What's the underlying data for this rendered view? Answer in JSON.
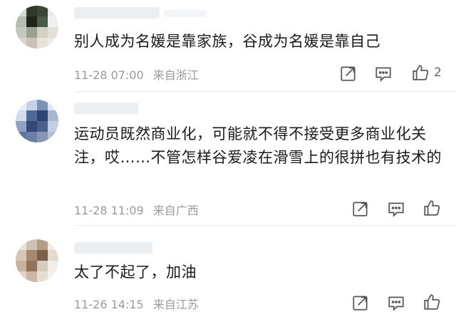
{
  "comments": [
    {
      "text": "别人成为名媛是靠家族，谷成为名媛是靠自己",
      "time": "11-28 07:00",
      "location": "来自浙江",
      "like_count": "2"
    },
    {
      "text": "运动员既然商业化，可能就不得不接受更多商业化关注，哎……不管怎样谷爱凌在滑雪上的很拼也有技术的",
      "time": "11-28 11:09",
      "location": "来自广西",
      "like_count": ""
    },
    {
      "text": "太了不起了，加油",
      "time": "11-26 14:15",
      "location": "来自江苏",
      "like_count": ""
    }
  ],
  "icons": {
    "share": "share-icon",
    "reply": "comment-icon",
    "like": "thumbs-up-icon"
  },
  "colors": {
    "text": "#1a1a1a",
    "meta": "#9a9a9a",
    "icon": "#555555"
  }
}
